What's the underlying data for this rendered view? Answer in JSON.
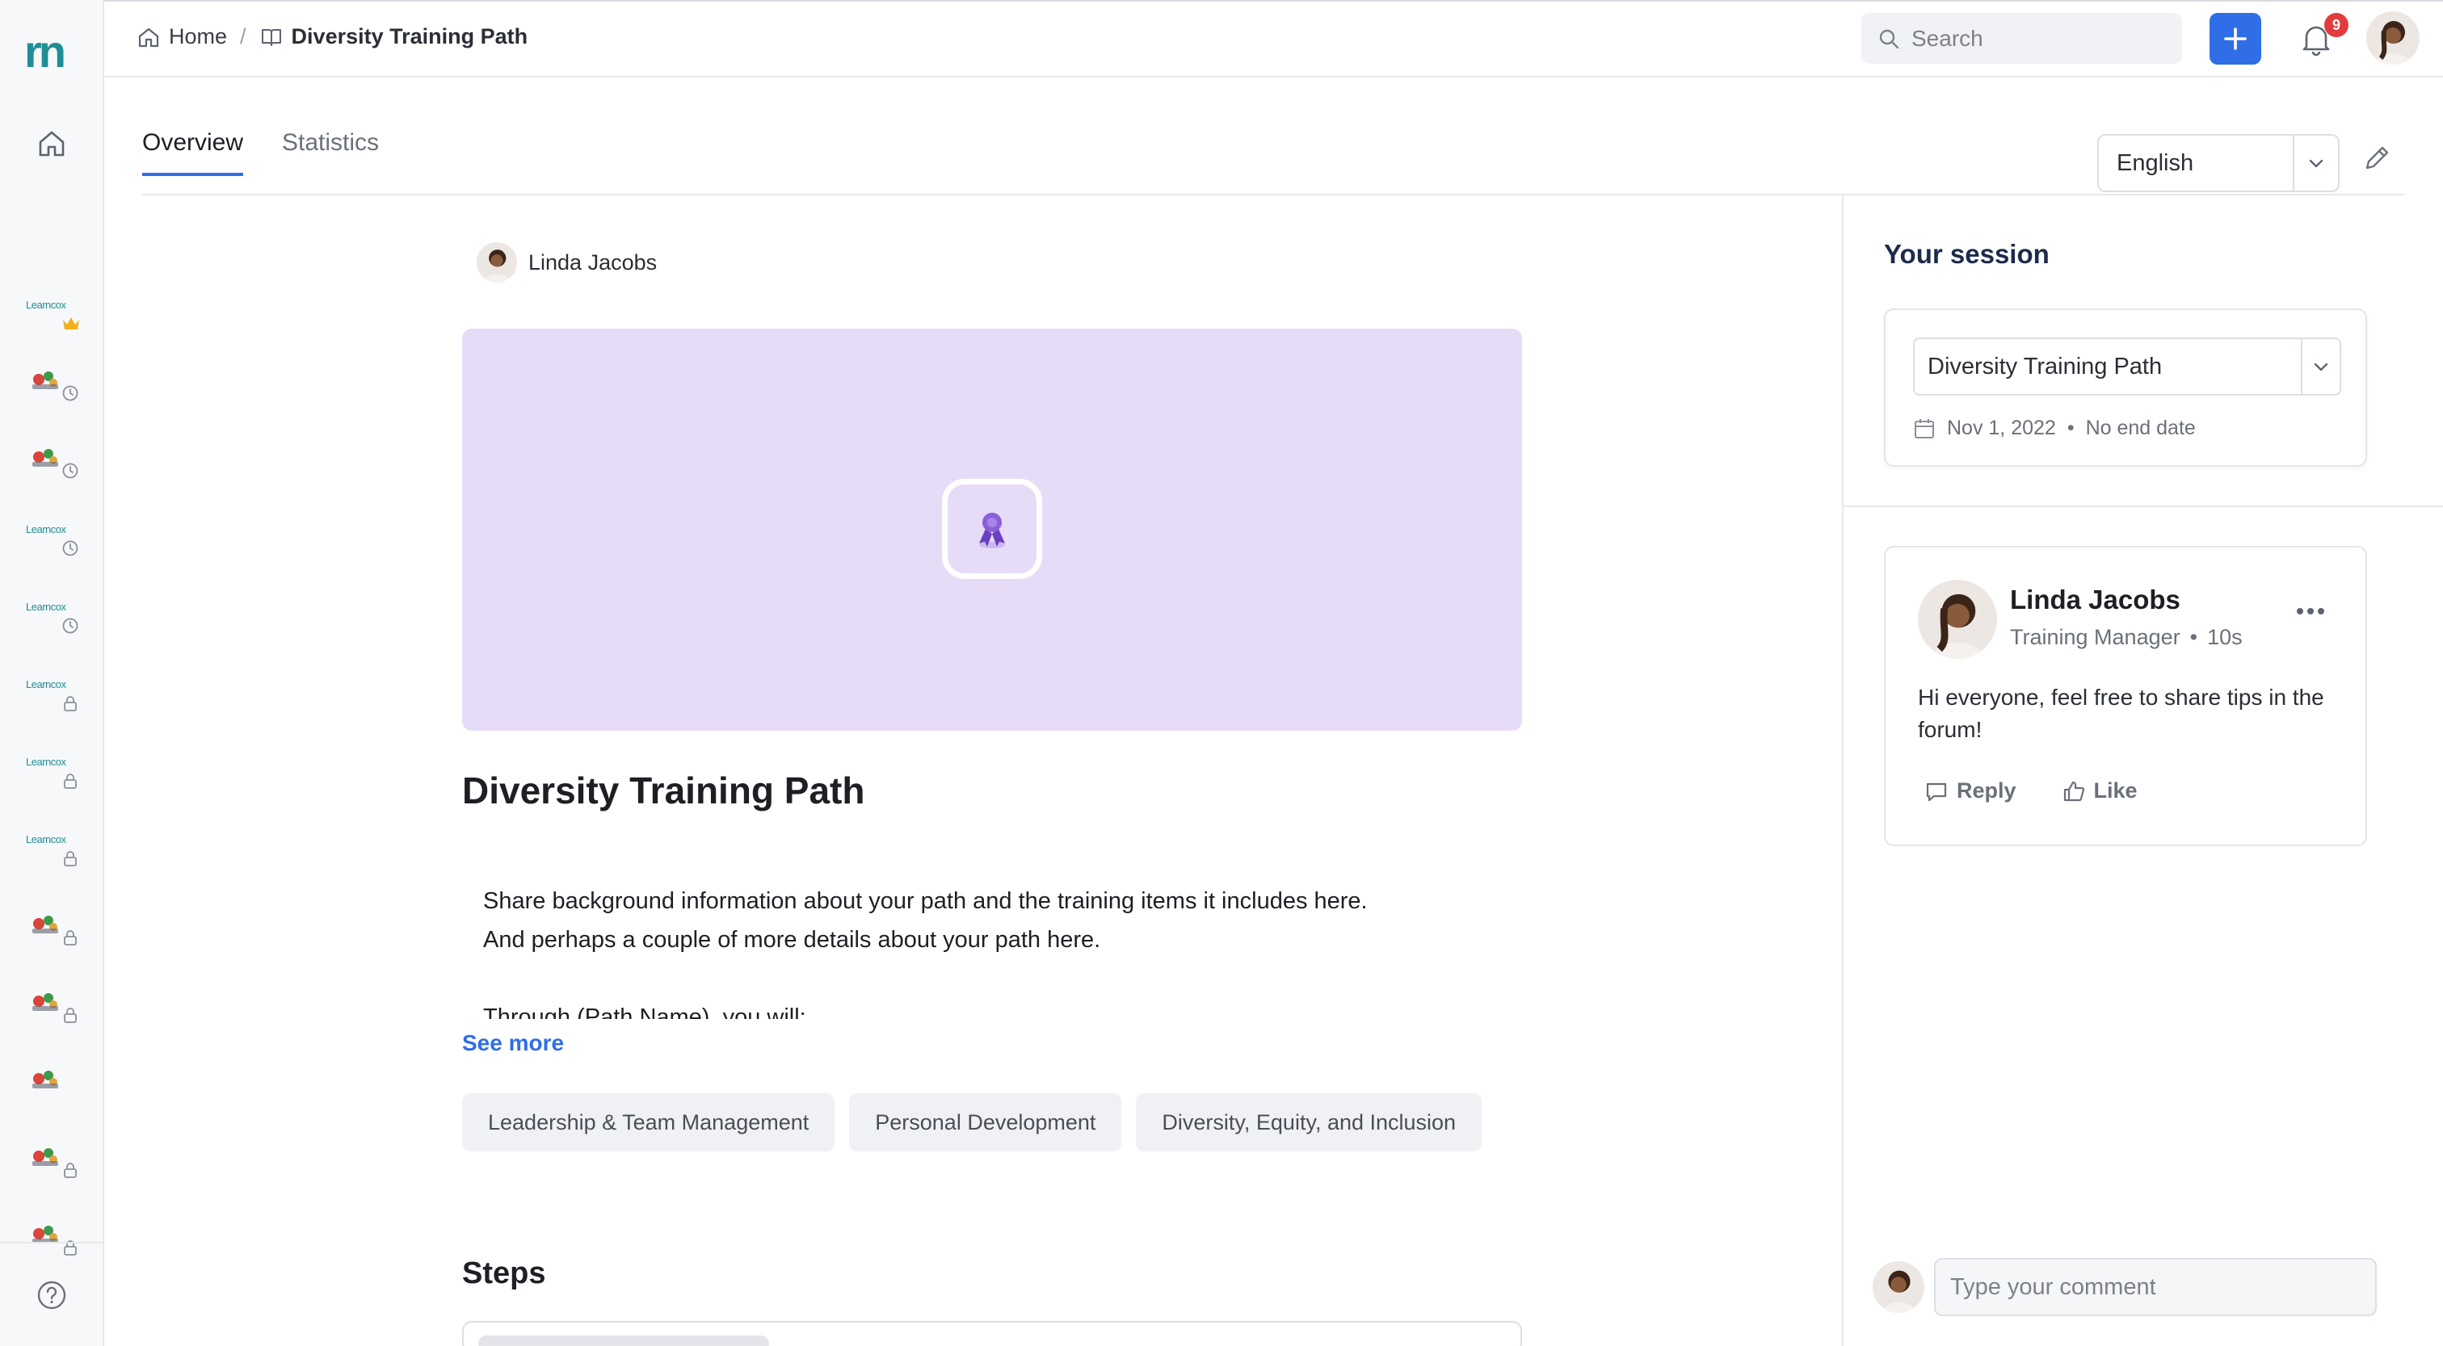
{
  "app": {
    "logo_text": "rn"
  },
  "rail": {
    "items": [
      {
        "kind": "logo",
        "text": "Learncox",
        "badge": "crown"
      },
      {
        "kind": "image",
        "badge": "clock"
      },
      {
        "kind": "image",
        "badge": "clock"
      },
      {
        "kind": "logo",
        "text": "Learncox",
        "badge": "clock"
      },
      {
        "kind": "logo",
        "text": "Learncox",
        "badge": "clock"
      },
      {
        "kind": "logo",
        "text": "Learncox",
        "badge": "lock"
      },
      {
        "kind": "logo",
        "text": "Learncox",
        "badge": "lock"
      },
      {
        "kind": "logo",
        "text": "Learncox",
        "badge": "lock"
      },
      {
        "kind": "image",
        "badge": "lock"
      },
      {
        "kind": "image",
        "badge": "lock"
      },
      {
        "kind": "image",
        "badge": "none"
      },
      {
        "kind": "image",
        "badge": "lock"
      },
      {
        "kind": "image",
        "badge": "lock"
      }
    ]
  },
  "breadcrumb": {
    "home": "Home",
    "separator": "/",
    "current": "Diversity Training Path"
  },
  "search": {
    "placeholder": "Search"
  },
  "notifications": {
    "count": "9"
  },
  "tabs": [
    {
      "label": "Overview",
      "active": true
    },
    {
      "label": "Statistics",
      "active": false
    }
  ],
  "language": {
    "selected": "English"
  },
  "path": {
    "author": "Linda Jacobs",
    "title": "Diversity Training Path",
    "description": [
      "Share background information about your path and the training items it includes here.",
      "And perhaps a couple of more details about your path here.",
      "",
      "Through (Path Name), you will:"
    ],
    "see_more": "See more",
    "tags": [
      "Leadership & Team Management",
      "Personal Development",
      "Diversity, Equity, and Inclusion"
    ],
    "steps_heading": "Steps",
    "hero_color": "#e6dcf7"
  },
  "session": {
    "heading": "Your session",
    "selected": "Diversity Training Path",
    "start_date": "Nov 1, 2022",
    "dot": "•",
    "end_date": "No end date"
  },
  "post": {
    "author": "Linda Jacobs",
    "role": "Training Manager",
    "dot": "•",
    "time": "10s",
    "text": "Hi everyone, feel free to share tips in the forum!",
    "reply_label": "Reply",
    "like_label": "Like"
  },
  "comment": {
    "placeholder": "Type your comment"
  },
  "colors": {
    "accent": "#2f6ee6",
    "brand": "#1f8f95",
    "badge": "#e23b3b",
    "ribbon": "#6a3fc2"
  }
}
